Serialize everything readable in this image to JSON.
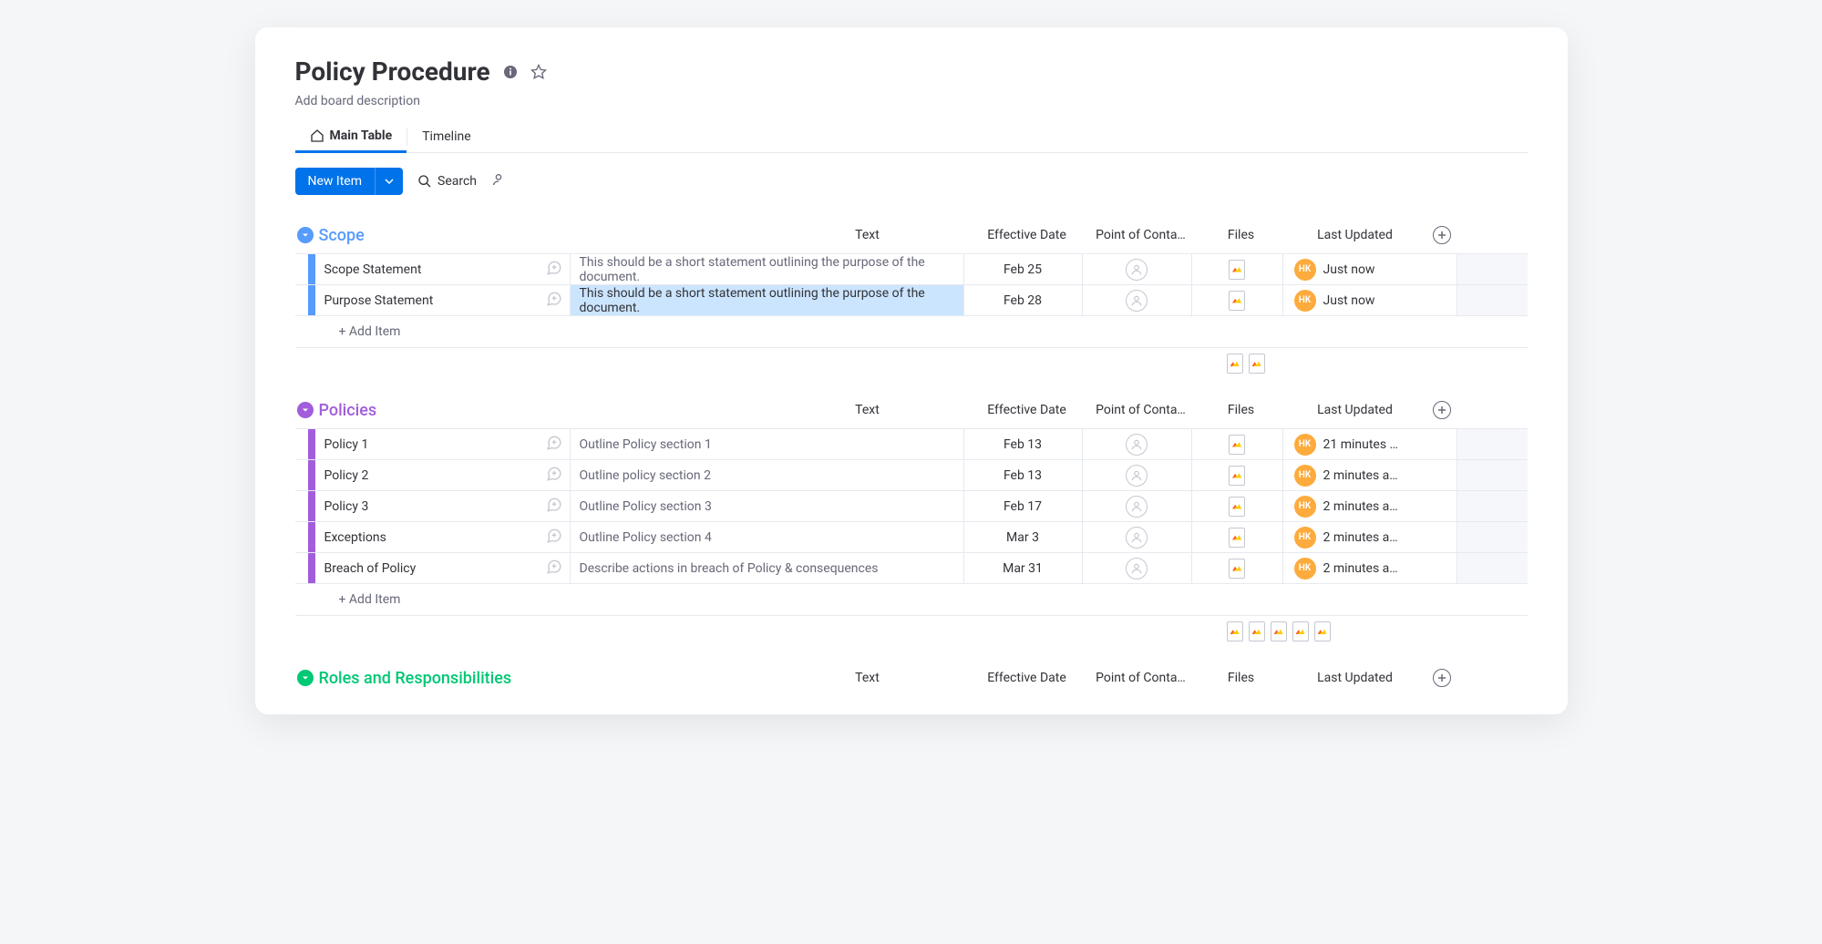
{
  "board": {
    "title": "Policy Procedure",
    "description_placeholder": "Add board description"
  },
  "tabs": {
    "main": "Main Table",
    "timeline": "Timeline"
  },
  "toolbar": {
    "new_item": "New Item",
    "search": "Search"
  },
  "columns": {
    "text": "Text",
    "effective_date": "Effective Date",
    "point_of_contact": "Point of Conta…",
    "files": "Files",
    "last_updated": "Last Updated"
  },
  "add_item_label": "+ Add Item",
  "avatar_initials": "HK",
  "groups": [
    {
      "id": "scope",
      "name": "Scope",
      "color_class": "scope",
      "rows": [
        {
          "name": "Scope Statement",
          "text": "This should be a short statement outlining the purpose of the document.",
          "date": "Feb 25",
          "updated": "Just now",
          "selected": false
        },
        {
          "name": "Purpose Statement",
          "text": "This should be a short statement outlining the purpose of the document.",
          "date": "Feb 28",
          "updated": "Just now",
          "selected": true
        }
      ],
      "summary_files": 2
    },
    {
      "id": "policies",
      "name": "Policies",
      "color_class": "policies",
      "rows": [
        {
          "name": "Policy 1",
          "text": "Outline Policy section 1",
          "date": "Feb 13",
          "updated": "21 minutes …",
          "selected": false
        },
        {
          "name": "Policy 2",
          "text": "Outline policy section 2",
          "date": "Feb 13",
          "updated": "2 minutes a…",
          "selected": false
        },
        {
          "name": "Policy 3",
          "text": "Outline Policy section 3",
          "date": "Feb 17",
          "updated": "2 minutes a…",
          "selected": false
        },
        {
          "name": "Exceptions",
          "text": "Outline Policy section 4",
          "date": "Mar 3",
          "updated": "2 minutes a…",
          "selected": false
        },
        {
          "name": "Breach of Policy",
          "text": "Describe actions in breach of Policy & consequences",
          "date": "Mar 31",
          "updated": "2 minutes a…",
          "selected": false
        }
      ],
      "summary_files": 5
    },
    {
      "id": "roles",
      "name": "Roles and Responsibilities",
      "color_class": "roles",
      "rows": [],
      "summary_files": 0
    }
  ]
}
